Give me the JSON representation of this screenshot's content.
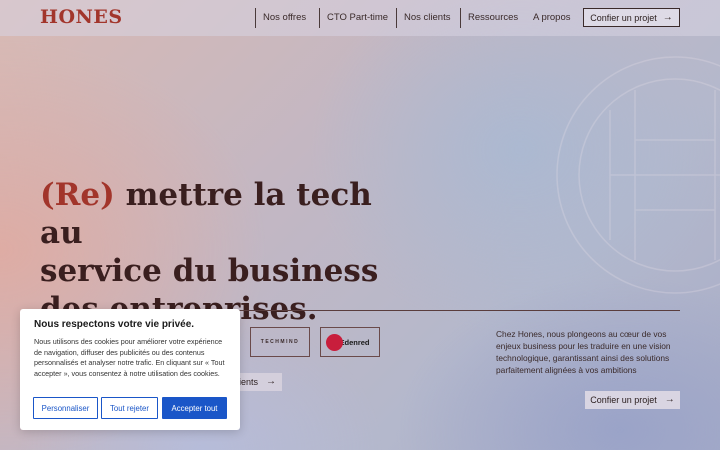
{
  "brand": {
    "logo_text": "HONES",
    "accent_color": "#a2352b"
  },
  "nav": {
    "items": [
      {
        "label": "Nos offres"
      },
      {
        "label": "CTO Part-time"
      },
      {
        "label": "Nos clients"
      },
      {
        "label": "Ressources"
      },
      {
        "label": "A propos"
      }
    ],
    "cta_label": "Confier un projet",
    "cta_icon": "arrow-right-icon"
  },
  "hero": {
    "accent": "(Re)",
    "title_line1_rest": " mettre la tech au",
    "title_line2": "service du business",
    "title_line3": "des entreprises."
  },
  "clients": {
    "logos": [
      {
        "name": "TECHMIND"
      },
      {
        "name": "Edenred",
        "badge_color": "#c81e3c"
      }
    ],
    "button_label": "clients",
    "button_icon": "arrow-right-icon"
  },
  "intro": {
    "text": "Chez Hones, nous plongeons au cœur de vos enjeux business pour les traduire en une vision technologique, garantissant ainsi des solutions parfaitement alignées à vos ambitions",
    "cta_label": "Confier un projet",
    "cta_icon": "arrow-right-icon"
  },
  "cookie_banner": {
    "title": "Nous respectons votre vie privée.",
    "text": "Nous utilisons des cookies pour améliorer votre expérience de navigation, diffuser des publicités ou des contenus personnalisés et analyser notre trafic. En cliquant sur « Tout accepter », vous consentez à notre utilisation des cookies.",
    "buttons": {
      "customize": "Personnaliser",
      "reject": "Tout rejeter",
      "accept": "Accepter tout"
    },
    "primary_color": "#1a56c8"
  }
}
